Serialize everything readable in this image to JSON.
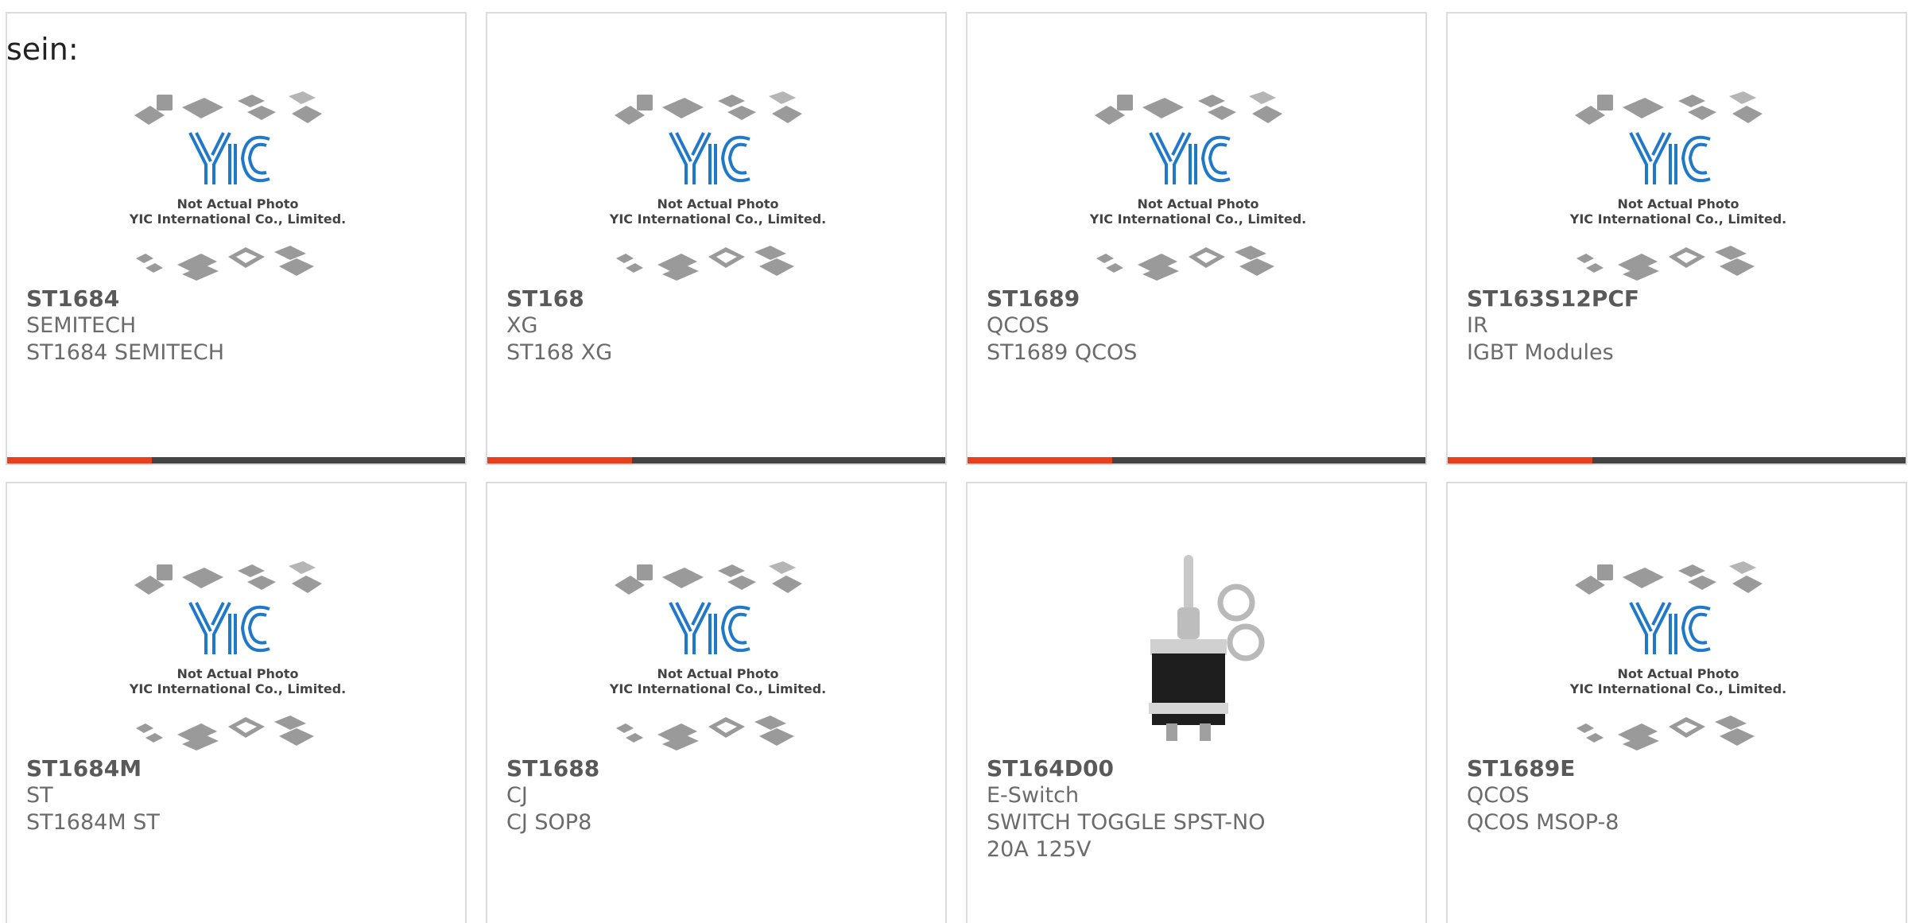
{
  "page": {
    "top_text": "sein:"
  },
  "placeholder_image": {
    "line1": "Not Actual Photo",
    "line2": "YIC International Co., Limited."
  },
  "colors": {
    "accent": "#e8401c",
    "bar": "#444444",
    "border": "#dcdcdc",
    "logo_blue": "#1f78c8"
  },
  "products": [
    {
      "part": "ST1684",
      "brand": "SEMITECH",
      "desc": "ST1684 SEMITECH",
      "image": "placeholder"
    },
    {
      "part": "ST168",
      "brand": "XG",
      "desc": "ST168 XG",
      "image": "placeholder"
    },
    {
      "part": "ST1689",
      "brand": "QCOS",
      "desc": "ST1689 QCOS",
      "image": "placeholder"
    },
    {
      "part": "ST163S12PCF",
      "brand": "IR",
      "desc": "IGBT Modules",
      "image": "placeholder"
    },
    {
      "part": "ST1684M",
      "brand": "ST",
      "desc": "ST1684M ST",
      "image": "placeholder"
    },
    {
      "part": "ST1688",
      "brand": "CJ",
      "desc": "CJ SOP8",
      "image": "placeholder"
    },
    {
      "part": "ST164D00",
      "brand": "E-Switch",
      "desc": "SWITCH TOGGLE SPST-NO 20A 125V",
      "image": "toggle-switch-photo"
    },
    {
      "part": "ST1689E",
      "brand": "QCOS",
      "desc": "QCOS MSOP-8",
      "image": "placeholder"
    }
  ]
}
